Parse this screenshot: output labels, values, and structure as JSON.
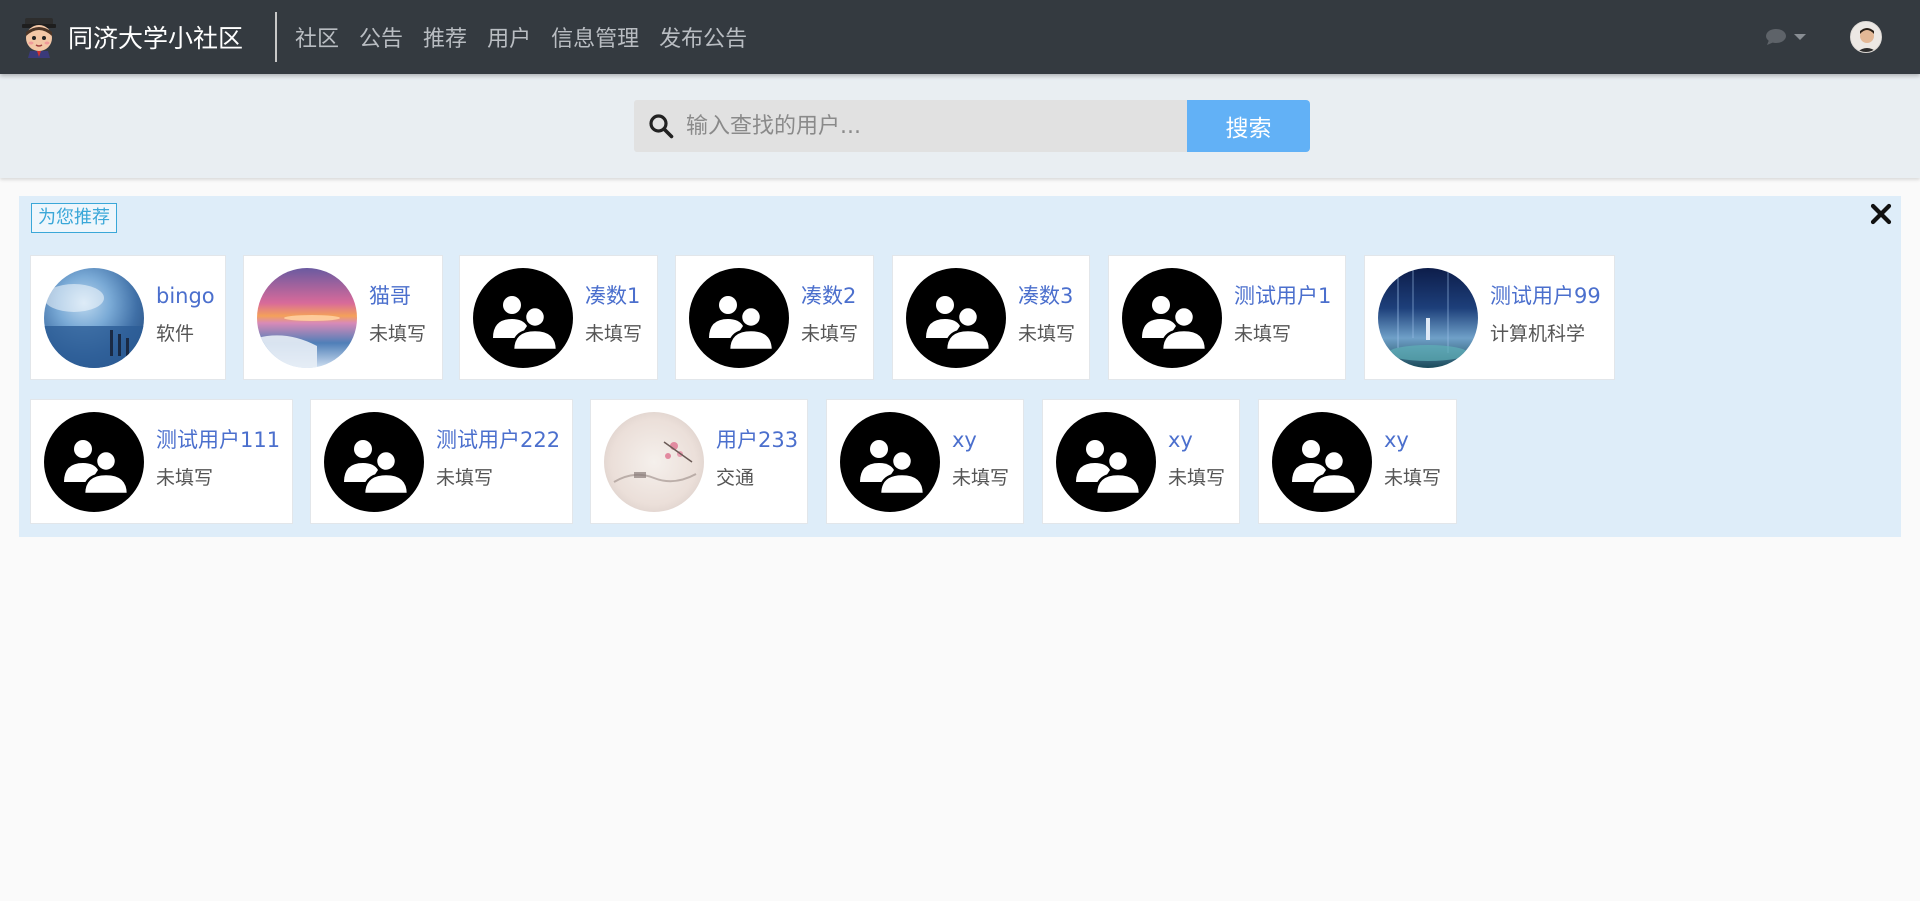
{
  "navbar": {
    "brand_title": "同济大学小社区",
    "links": [
      "社区",
      "公告",
      "推荐",
      "用户",
      "信息管理",
      "发布公告"
    ],
    "icons": {
      "logo": "mascot-logo-icon",
      "messages": "chat-bubble-icon",
      "dropdown": "chevron-down-icon",
      "user": "user-avatar"
    },
    "colors": {
      "background": "#343a40",
      "link": "#b9bdc2"
    }
  },
  "search": {
    "placeholder": "输入查找的用户...",
    "button_label": "搜索",
    "icon": "search-icon",
    "colors": {
      "button": "#62b1f6",
      "input_bg": "#e1e1e1"
    }
  },
  "recommendations": {
    "badge_label": "为您推荐",
    "close_icon": "close-icon",
    "colors": {
      "panel_bg": "#deedf9",
      "name": "#4b6fcd"
    },
    "users": [
      {
        "name": "bingo",
        "major": "软件",
        "avatar": "sea-landscape-photo"
      },
      {
        "name": "猫哥",
        "major": "未填写",
        "avatar": "sunset-sea-photo"
      },
      {
        "name": "凑数1",
        "major": "未填写",
        "avatar": "default-user-icon"
      },
      {
        "name": "凑数2",
        "major": "未填写",
        "avatar": "default-user-icon"
      },
      {
        "name": "凑数3",
        "major": "未填写",
        "avatar": "default-user-icon"
      },
      {
        "name": "测试用户1",
        "major": "未填写",
        "avatar": "default-user-icon"
      },
      {
        "name": "测试用户99",
        "major": "计算机科学",
        "avatar": "night-anime-photo"
      },
      {
        "name": "测试用户111",
        "major": "未填写",
        "avatar": "default-user-icon"
      },
      {
        "name": "测试用户222",
        "major": "未填写",
        "avatar": "default-user-icon"
      },
      {
        "name": "用户233",
        "major": "交通",
        "avatar": "ink-painting-photo"
      },
      {
        "name": "xy",
        "major": "未填写",
        "avatar": "default-user-icon"
      },
      {
        "name": "xy",
        "major": "未填写",
        "avatar": "default-user-icon"
      },
      {
        "name": "xy",
        "major": "未填写",
        "avatar": "default-user-icon"
      }
    ]
  }
}
